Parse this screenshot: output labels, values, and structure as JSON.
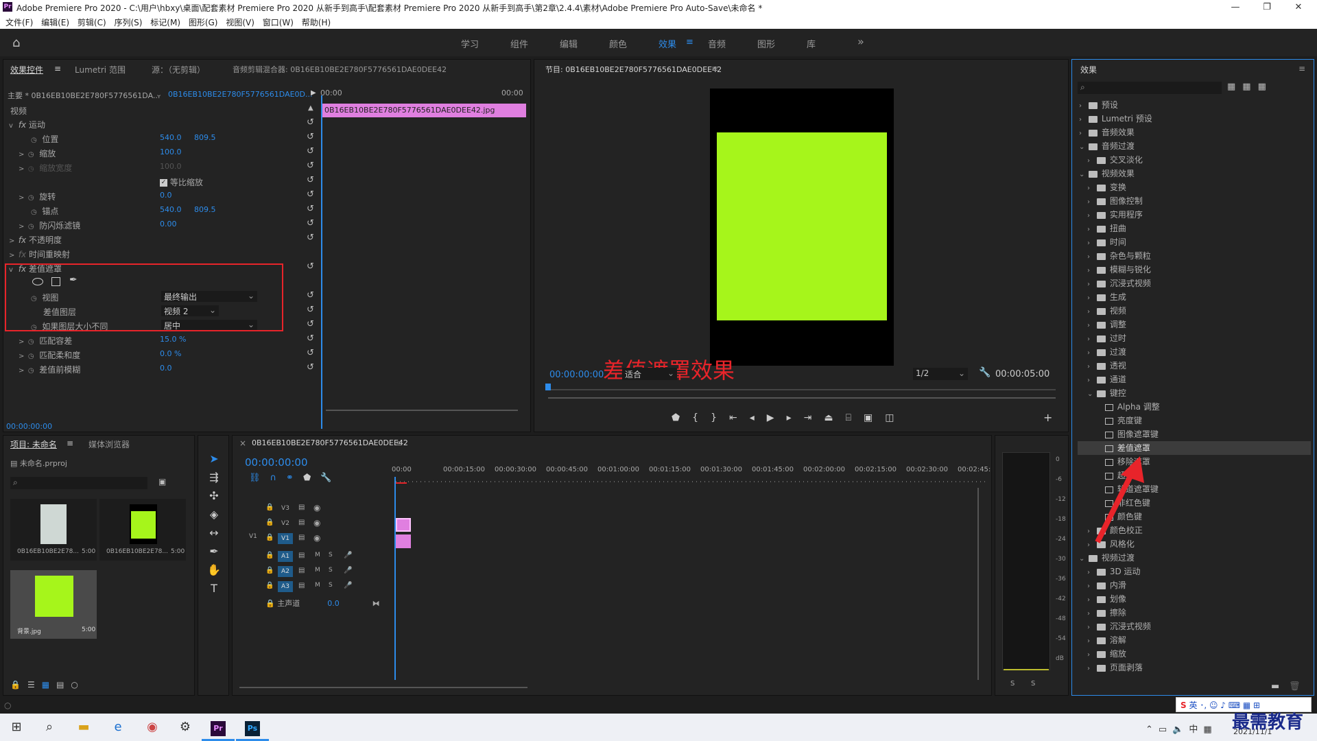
{
  "window": {
    "title": "Adobe Premiere Pro 2020 - C:\\用户\\hbxy\\桌面\\配套素材 Premiere Pro 2020 从新手到高手\\配套素材 Premiere Pro 2020 从新手到高手\\第2章\\2.4.4\\素材\\Adobe Premiere Pro Auto-Save\\未命名 *",
    "app_badge": "Pr",
    "min": "—",
    "max": "❐",
    "close": "✕"
  },
  "menu": [
    "文件(F)",
    "编辑(E)",
    "剪辑(C)",
    "序列(S)",
    "标记(M)",
    "图形(G)",
    "视图(V)",
    "窗口(W)",
    "帮助(H)"
  ],
  "workspaces": [
    "学习",
    "组件",
    "编辑",
    "颜色",
    "效果",
    "音频",
    "图形",
    "库"
  ],
  "workspace_active": "效果",
  "workspace_more": "»",
  "effect_controls": {
    "tabs": [
      "效果控件",
      "Lumetri 范围",
      "源：（无剪辑）",
      "音频剪辑混合器: 0B16EB10BE2E780F5776561DAE0DEE42"
    ],
    "master": "主要 * 0B16EB10BE2E780F5776561DA...",
    "seq": "0B16EB10BE2E780F5776561DAE0D...",
    "time_start": "00:00",
    "time_end": "00:00",
    "clip_name": "0B16EB10BE2E780F5776561DAE0DEE42.jpg",
    "video_label": "视频",
    "motion": "运动",
    "position": "位置",
    "position_x": "540.0",
    "position_y": "809.5",
    "scale": "缩放",
    "scale_v": "100.0",
    "scale_w": "缩放宽度",
    "scale_w_v": "100.0",
    "uniform": "等比缩放",
    "rotation": "旋转",
    "rotation_v": "0.0",
    "anchor": "锚点",
    "anchor_x": "540.0",
    "anchor_y": "809.5",
    "flicker": "防闪烁滤镜",
    "flicker_v": "0.00",
    "opacity": "不透明度",
    "remap": "时间重映射",
    "diff_matte": "差值遮罩",
    "view": "视图",
    "view_v": "最终输出",
    "diff_layer": "差值图层",
    "diff_layer_v": "视频 2",
    "if_size": "如果图层大小不同",
    "if_size_v": "居中",
    "tolerance": "匹配容差",
    "tolerance_v": "15.0 %",
    "softness": "匹配柔和度",
    "softness_v": "0.0 %",
    "blur": "差值前模糊",
    "blur_v": "0.0",
    "timecode": "00:00:00:00"
  },
  "program": {
    "title": "节目: 0B16EB10BE2E780F5776561DAE0DEE42",
    "timecode": "00:00:00:00",
    "fit": "适合",
    "res": "1/2",
    "duration": "00:00:05:00",
    "overlay_caption": "差值遮罩效果",
    "frame_color": "#a6f51b"
  },
  "project": {
    "tabs": [
      "项目: 未命名",
      "媒体浏览器"
    ],
    "file": "未命名.prproj",
    "items": [
      {
        "name": "0B16EB10BE2E78...",
        "dur": "5:00"
      },
      {
        "name": "0B16EB10BE2E78...",
        "dur": "5:00"
      },
      {
        "name": "背景.jpg",
        "dur": "5:00"
      }
    ]
  },
  "timeline": {
    "tab": "0B16EB10BE2E780F5776561DAE0DEE42",
    "timecode": "00:00:00:00",
    "ruler": [
      "00:00",
      "00:00:15:00",
      "00:00:30:00",
      "00:00:45:00",
      "00:01:00:00",
      "00:01:15:00",
      "00:01:30:00",
      "00:01:45:00",
      "00:02:00:00",
      "00:02:15:00",
      "00:02:30:00",
      "00:02:45:"
    ],
    "video_tracks": [
      "V3",
      "V2",
      "V1"
    ],
    "audio_tracks": [
      "A1",
      "A2",
      "A3"
    ],
    "source_v1": "V1",
    "master": "主声道",
    "master_v": "0.0",
    "m": "M",
    "s": "S"
  },
  "meter": {
    "ticks": [
      "0",
      "-6",
      "-12",
      "-18",
      "-24",
      "-30",
      "-36",
      "-42",
      "-48",
      "-54",
      "dB"
    ],
    "s1": "S",
    "s2": "S"
  },
  "effects_panel": {
    "title": "效果",
    "tree": [
      {
        "t": "预设",
        "lv": 0,
        "k": "f",
        "c": ">"
      },
      {
        "t": "Lumetri 预设",
        "lv": 0,
        "k": "f",
        "c": ">"
      },
      {
        "t": "音频效果",
        "lv": 0,
        "k": "f",
        "c": ">"
      },
      {
        "t": "音频过渡",
        "lv": 0,
        "k": "f",
        "c": "v"
      },
      {
        "t": "交叉淡化",
        "lv": 1,
        "k": "f",
        "c": ">"
      },
      {
        "t": "视频效果",
        "lv": 0,
        "k": "f",
        "c": "v"
      },
      {
        "t": "变换",
        "lv": 1,
        "k": "f",
        "c": ">"
      },
      {
        "t": "图像控制",
        "lv": 1,
        "k": "f",
        "c": ">"
      },
      {
        "t": "实用程序",
        "lv": 1,
        "k": "f",
        "c": ">"
      },
      {
        "t": "扭曲",
        "lv": 1,
        "k": "f",
        "c": ">"
      },
      {
        "t": "时间",
        "lv": 1,
        "k": "f",
        "c": ">"
      },
      {
        "t": "杂色与颗粒",
        "lv": 1,
        "k": "f",
        "c": ">"
      },
      {
        "t": "模糊与锐化",
        "lv": 1,
        "k": "f",
        "c": ">"
      },
      {
        "t": "沉浸式视频",
        "lv": 1,
        "k": "f",
        "c": ">"
      },
      {
        "t": "生成",
        "lv": 1,
        "k": "f",
        "c": ">"
      },
      {
        "t": "视频",
        "lv": 1,
        "k": "f",
        "c": ">"
      },
      {
        "t": "调整",
        "lv": 1,
        "k": "f",
        "c": ">"
      },
      {
        "t": "过时",
        "lv": 1,
        "k": "f",
        "c": ">"
      },
      {
        "t": "过渡",
        "lv": 1,
        "k": "f",
        "c": ">"
      },
      {
        "t": "透视",
        "lv": 1,
        "k": "f",
        "c": ">"
      },
      {
        "t": "通道",
        "lv": 1,
        "k": "f",
        "c": ">"
      },
      {
        "t": "键控",
        "lv": 1,
        "k": "f",
        "c": "v"
      },
      {
        "t": "Alpha 调整",
        "lv": 2,
        "k": "p",
        "c": ""
      },
      {
        "t": "亮度键",
        "lv": 2,
        "k": "p",
        "c": ""
      },
      {
        "t": "图像遮罩键",
        "lv": 2,
        "k": "p",
        "c": ""
      },
      {
        "t": "差值遮罩",
        "lv": 2,
        "k": "p",
        "c": "",
        "sel": true
      },
      {
        "t": "移除遮罩",
        "lv": 2,
        "k": "p",
        "c": ""
      },
      {
        "t": "超级键",
        "lv": 2,
        "k": "p",
        "c": ""
      },
      {
        "t": "轨道遮罩键",
        "lv": 2,
        "k": "p",
        "c": ""
      },
      {
        "t": "非红色键",
        "lv": 2,
        "k": "p",
        "c": ""
      },
      {
        "t": "颜色键",
        "lv": 2,
        "k": "p",
        "c": ""
      },
      {
        "t": "颜色校正",
        "lv": 1,
        "k": "f",
        "c": ">"
      },
      {
        "t": "风格化",
        "lv": 1,
        "k": "f",
        "c": ">"
      },
      {
        "t": "视频过渡",
        "lv": 0,
        "k": "f",
        "c": "v"
      },
      {
        "t": "3D 运动",
        "lv": 1,
        "k": "f",
        "c": ">"
      },
      {
        "t": "内滑",
        "lv": 1,
        "k": "f",
        "c": ">"
      },
      {
        "t": "划像",
        "lv": 1,
        "k": "f",
        "c": ">"
      },
      {
        "t": "擦除",
        "lv": 1,
        "k": "f",
        "c": ">"
      },
      {
        "t": "沉浸式视频",
        "lv": 1,
        "k": "f",
        "c": ">"
      },
      {
        "t": "溶解",
        "lv": 1,
        "k": "f",
        "c": ">"
      },
      {
        "t": "缩放",
        "lv": 1,
        "k": "f",
        "c": ">"
      },
      {
        "t": "页面剥落",
        "lv": 1,
        "k": "f",
        "c": ">"
      }
    ]
  },
  "tray": {
    "ime": "英",
    "time": "2021/11/1",
    "watermark": "最需教育"
  },
  "colors": {
    "accent": "#2d8ceb",
    "highlight_box": "#e8242a",
    "clip_pink": "#e07fe0",
    "green": "#a6f51b"
  }
}
